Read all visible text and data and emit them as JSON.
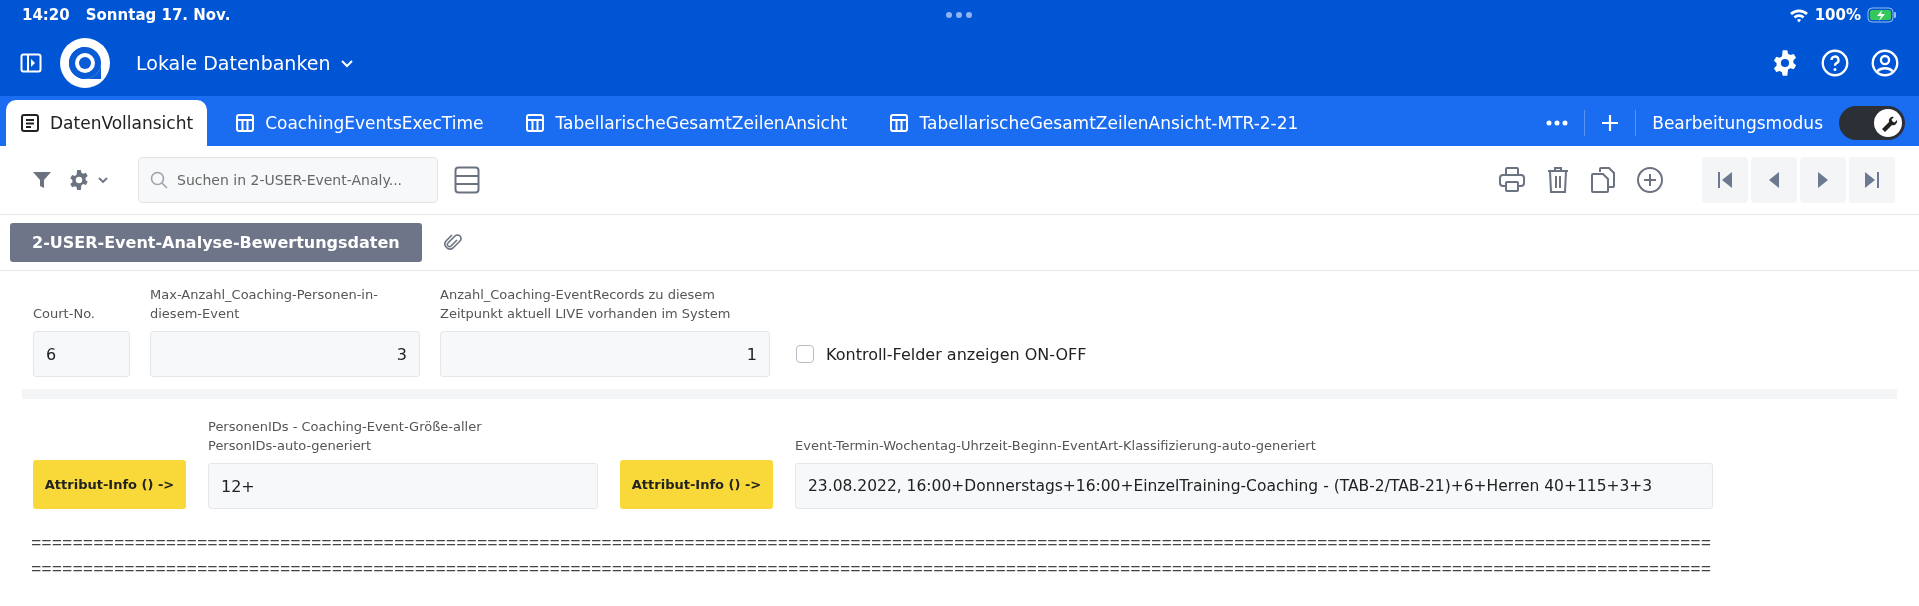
{
  "status_bar": {
    "time": "14:20",
    "date": "Sonntag 17. Nov.",
    "battery": "100%"
  },
  "header": {
    "title": "Lokale Datenbanken"
  },
  "tabs": [
    {
      "label": "DatenVollansicht",
      "kind": "document",
      "selected": true
    },
    {
      "label": "CoachingEventsExecTime",
      "kind": "table",
      "selected": false
    },
    {
      "label": "TabellarischeGesamtZeilenAnsicht",
      "kind": "table",
      "selected": false
    },
    {
      "label": "TabellarischeGesamtZeilenAnsicht-MTR-2-21",
      "kind": "table",
      "selected": false
    }
  ],
  "edit_mode": {
    "label": "Bearbeitungsmodus",
    "on": true
  },
  "search": {
    "placeholder": "Suchen in 2-USER-Event-Analy..."
  },
  "record_title": "2-USER-Event-Analyse-Bewertungsdaten",
  "row_1": [
    {
      "label": "Court-No.",
      "value": "6",
      "kind": "text"
    },
    {
      "label": "Max-Anzahl_Coaching-Personen-in-diesem-Event",
      "value": "3",
      "kind": "number"
    },
    {
      "label": "Anzahl_Coaching-EventRecords zu diesem Zeitpunkt aktuell LIVE vorhanden im System",
      "value": "1",
      "kind": "number"
    }
  ],
  "checkbox": {
    "label": "Kontroll-Felder anzeigen ON-OFF",
    "checked": false
  },
  "row_2": [
    {
      "button": "Attribut-Info () ->",
      "label": "PersonenIDs - Coaching-Event-Größe-aller PersonIDs-auto-generiert",
      "value": "12+"
    },
    {
      "button": "Attribut-Info () ->",
      "label": "Event-Termin-Wochentag-Uhrzeit-Beginn-EventArt-Klassifizierung-auto-generiert",
      "value": "23.08.2022, 16:00+Donnerstags+16:00+EinzelTraining-Coaching - (TAB-2/TAB-21)+6+Herren 40+115+3+3"
    }
  ],
  "separator_lines": [
    "==================================================================================================================================================================",
    "=================================================================================================================================================================="
  ]
}
